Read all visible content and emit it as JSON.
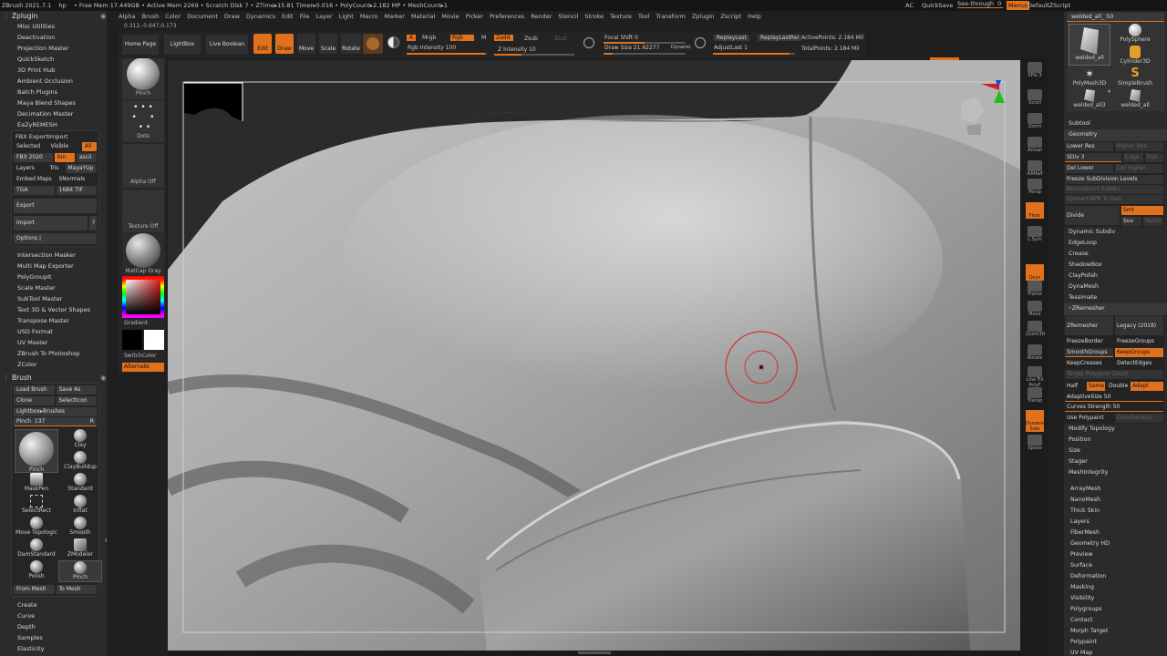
{
  "titlebar": {
    "app": "ZBrush 2021.7.1",
    "hp": "hp",
    "stats": "• Free Mem 17.449GB • Active Mem 2269 • Scratch Disk 7 • ZTime▸15.81 Timer▸0.016 • PolyCount▸2.182 MP • MeshCount▸1",
    "ac": "AC",
    "quicksave": "QuickSave",
    "seethrough": "See-through",
    "seethrough_val": "0",
    "menus": "Menus",
    "defaultzscript": "DefaultZScript"
  },
  "menubar": [
    "Alpha",
    "Brush",
    "Color",
    "Document",
    "Draw",
    "Dynamics",
    "Edit",
    "File",
    "Layer",
    "Light",
    "Macro",
    "Marker",
    "Material",
    "Movie",
    "Picker",
    "Preferences",
    "Render",
    "Stencil",
    "Stroke",
    "Texture",
    "Tool",
    "Transform",
    "Zplugin",
    "Zscript",
    "Help"
  ],
  "coords": "0.312,-0.647,0.173",
  "zplugin": {
    "title": "Zplugin",
    "items_top": [
      "Misc Utilities",
      "Deactivation",
      "Projection Master",
      "QuickSketch",
      "3D Print Hub",
      "Ambient Occlusion",
      "Batch Plugins",
      "Maya Blend Shapes",
      "Decimation Master",
      "EaZyREMESH"
    ],
    "fbx": {
      "title": "FBX ExportImport",
      "selected": "Selected",
      "visible": "Visible",
      "all": "All",
      "fbx2020": "FBX 2020",
      "bin": "bin",
      "ascii": "ascii",
      "layers": "Layers",
      "tris": "Tris",
      "mayayup": "MayaYUp",
      "embedmaps": "Embed Maps",
      "snormals": "SNormals",
      "tga": "TGA",
      "tif": "16Bit TIF",
      "export": "Export",
      "import": "Import",
      "q": "?",
      "options": "Options |"
    },
    "items_bottom": [
      "Intersection Masker",
      "Multi Map Exporter",
      "PolyGroupIt",
      "Scale Master",
      "SubTool Master",
      "Text 3D & Vector Shapes",
      "Transpose Master",
      "USD Format",
      "UV Master",
      "ZBrush To Photoshop",
      "ZColor"
    ]
  },
  "brush": {
    "title": "Brush",
    "load": "Load Brush",
    "saveas": "Save As",
    "clone": "Clone",
    "selecticon": "SelectIcon",
    "lightbox": "Lightbox▸Brushes",
    "pinch_label": "Pinch",
    "pinch_val": "137",
    "r": "R",
    "big": "Pinch",
    "cells": [
      "Clay",
      "ClayBuildup",
      "MaskPen",
      "Standard",
      "SelectRect",
      "Inflat",
      "Move Topologic",
      "Smooth",
      "DamStandard",
      "ZModeler",
      "Polish",
      "Pinch"
    ],
    "badge": "1",
    "frommesh": "From Mesh",
    "tomesh": "To Mesh",
    "after": [
      "Create",
      "Curve",
      "Depth",
      "Samples",
      "Elasticity"
    ]
  },
  "toolcol": {
    "pinch": "Pinch",
    "dots": "Dots",
    "alphaoff": "Alpha Off",
    "textureoff": "Texture Off",
    "matcap": "MatCap Gray",
    "gradient": "Gradient",
    "switchcolor": "SwitchColor",
    "alternate": "Alternate"
  },
  "toptool": {
    "homepage": "Home Page",
    "lightbox": "LightBox",
    "liveboolean": "Live Boolean",
    "edit": "Edit",
    "draw": "Draw",
    "move": "Move",
    "scale": "Scale",
    "rotate": "Rotate",
    "a": "A",
    "mrgb": "Mrgb",
    "rgb": "Rgb",
    "m": "M",
    "zadd": "Zadd",
    "zsub": "Zsub",
    "zcut": "Zcut",
    "rgbint": "Rgb Intensity 100",
    "zint": "Z Intensity 10",
    "focal": "Focal Shift 0",
    "drawsize": "Draw Size 21.62277",
    "dynamic": "Dynamic",
    "replaylast": "ReplayLast",
    "replaylastrel": "ReplayLastRel",
    "adjustlast": "AdjustLast 1",
    "activepoints": "ActivePoints: 2.184 Mil",
    "totalpoints": "TotalPoints: 2.184 Mil"
  },
  "rshelf": [
    "SPix 3",
    "Scroll",
    "Zoom",
    "Actual",
    "AAHalf",
    "Persp",
    "Floor",
    "L.Sym",
    "Qxyz",
    "Frame",
    "Move",
    "Zoom3D",
    "Rotate",
    "Line Fill PolyF",
    "Transp",
    "Dynamic Solo",
    "Xpose"
  ],
  "rpanel": {
    "slider": "welded_all_ 50",
    "thumbs": [
      "welded_all",
      "PolySphere",
      "Cylinder3D",
      "PolyMesh3D",
      "SimpleBrush",
      "welded_all3",
      "welded_all"
    ],
    "thumb_badge": "4",
    "subtool": "Subtool",
    "geometry": "Geometry",
    "lowerres": "Lower Res",
    "higherres": "Higher Res",
    "sdiv": "SDiv 3",
    "cage": "Cage",
    "rstr": "Rstr",
    "dellower": "Del Lower",
    "delhigher": "Del Higher",
    "freeze": "Freeze SubDivision Levels",
    "reconstruct": "Reconstruct Subdiv",
    "convertbpr": "Convert BPR To Geo",
    "divide": "Divide",
    "smt": "Smt",
    "suv": "Suv",
    "reluv": "RelUV",
    "list1": [
      "Dynamic Subdiv",
      "EdgeLoop",
      "Crease",
      "ShadowBox",
      "ClayPolish",
      "DynaMesh",
      "Tessimate"
    ],
    "zremesher_h": "ZRemesher",
    "zremesher": "ZRemesher",
    "legacy": "Legacy (2018)",
    "freezeborder": "FreezeBorder",
    "freezegroups": "FreezeGroups",
    "smoothgroups": "SmoothGroups",
    "keepgroups": "KeepGroups",
    "keepcreases": "KeepCreases",
    "detectedges": "DetectEdges",
    "targetpoly": "Target Polygons Count",
    "half": "Half",
    "same": "Same",
    "double": "Double",
    "adapt": "Adapt",
    "adaptivesize": "AdaptiveSize 50",
    "curvesstrength": "Curves Strength 50",
    "usepolypaint": "Use Polypaint",
    "colordensity": "ColorDensity",
    "list2": [
      "Modify Topology",
      "Position",
      "Size",
      "Stager",
      "MeshIntegrity"
    ],
    "list3": [
      "ArrayMesh",
      "NanoMesh",
      "Thick Skin",
      "Layers",
      "FiberMesh",
      "Geometry HD",
      "Preview",
      "Surface",
      "Deformation",
      "Masking",
      "Visibility",
      "Polygroups",
      "Contact",
      "Morph Target",
      "Polypaint",
      "UV Map"
    ]
  }
}
